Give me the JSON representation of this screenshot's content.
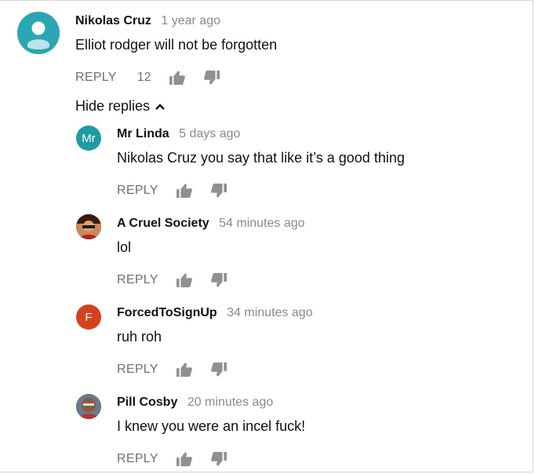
{
  "top_comment": {
    "author": "Nikolas Cruz",
    "time": "1 year ago",
    "text": "Elliot rodger will not be forgotten",
    "reply_label": "REPLY",
    "likes": "12",
    "avatar_icon": "default-person-icon",
    "avatar_color": "#2aa6b4"
  },
  "hide_replies_label": "Hide replies",
  "replies": [
    {
      "author": "Mr Linda",
      "time": "5 days ago",
      "text": "Nikolas Cruz you say that like it’s a good thing",
      "reply_label": "REPLY",
      "avatar_initials": "Mr",
      "avatar_color": "#1e9aa6"
    },
    {
      "author": "A Cruel Society",
      "time": "54 minutes ago",
      "text": "lol",
      "reply_label": "REPLY",
      "avatar_icon": "photo-avatar-icon",
      "avatar_color": "#7a2a1a"
    },
    {
      "author": "ForcedToSignUp",
      "time": "34 minutes ago",
      "text": "ruh roh",
      "reply_label": "REPLY",
      "avatar_initials": "F",
      "avatar_color": "#d4411f"
    },
    {
      "author": "Pill Cosby",
      "time": "20 minutes ago",
      "text": "I knew you were an incel fuck!",
      "reply_label": "REPLY",
      "avatar_icon": "photo-avatar-icon",
      "avatar_color": "#8a5a3a"
    }
  ]
}
